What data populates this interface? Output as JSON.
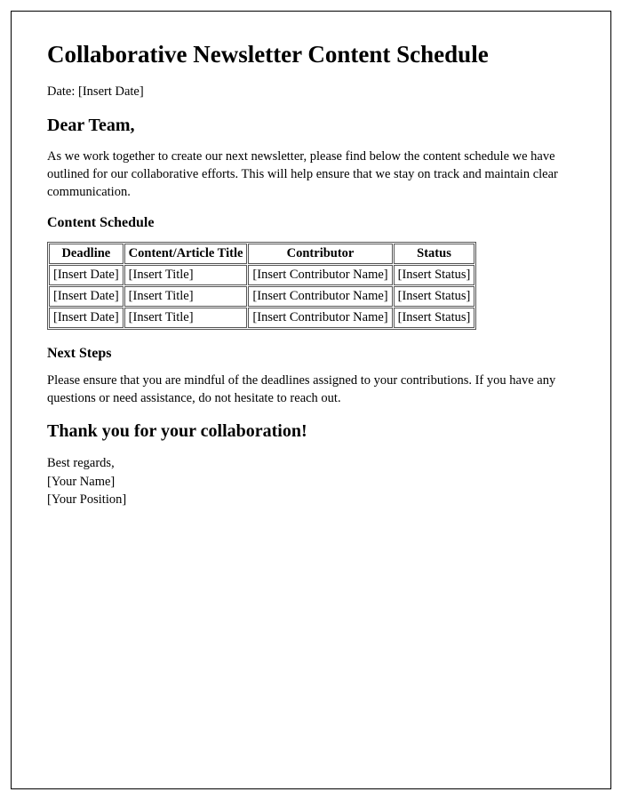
{
  "title": "Collaborative Newsletter Content Schedule",
  "dateLabel": "Date: [Insert Date]",
  "salutation": "Dear Team,",
  "intro": "As we work together to create our next newsletter, please find below the content schedule we have outlined for our collaborative efforts. This will help ensure that we stay on track and maintain clear communication.",
  "scheduleHeading": "Content Schedule",
  "table": {
    "headers": {
      "deadline": "Deadline",
      "title": "Content/Article Title",
      "contributor": "Contributor",
      "status": "Status"
    },
    "rows": [
      {
        "deadline": "[Insert Date]",
        "title": "[Insert Title]",
        "contributor": "[Insert Contributor Name]",
        "status": "[Insert Status]"
      },
      {
        "deadline": "[Insert Date]",
        "title": "[Insert Title]",
        "contributor": "[Insert Contributor Name]",
        "status": "[Insert Status]"
      },
      {
        "deadline": "[Insert Date]",
        "title": "[Insert Title]",
        "contributor": "[Insert Contributor Name]",
        "status": "[Insert Status]"
      }
    ]
  },
  "nextStepsHeading": "Next Steps",
  "nextStepsBody": "Please ensure that you are mindful of the deadlines assigned to your contributions. If you have any questions or need assistance, do not hesitate to reach out.",
  "thanks": "Thank you for your collaboration!",
  "closing": {
    "regards": "Best regards,",
    "name": "[Your Name]",
    "position": "[Your Position]"
  }
}
